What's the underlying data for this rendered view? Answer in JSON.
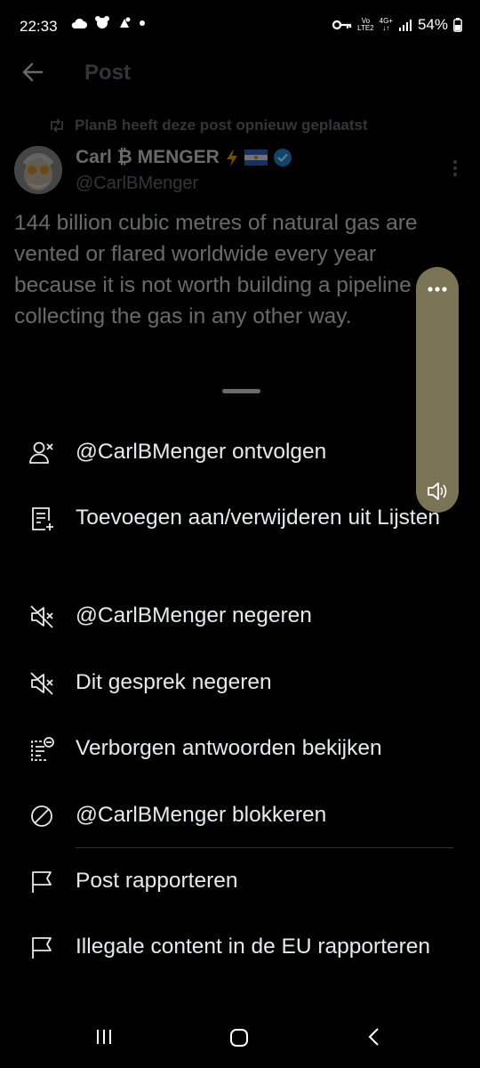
{
  "status_bar": {
    "time": "22:33",
    "network_top": "Vo",
    "network_bottom": "LTE2",
    "network_gen": "4G+",
    "battery": "54%"
  },
  "header": {
    "title": "Post"
  },
  "tweet": {
    "repost_note": "PlanB heeft deze post opnieuw geplaatst",
    "author_name": "Carl ₿ MENGER",
    "author_handle": "@CarlBMenger",
    "text": "144 billion cubic metres of natural gas are vented or flared worldwide every year because it is not worth building a pipeline or collecting the gas in any other way."
  },
  "menu": {
    "items": [
      {
        "label": "@CarlBMenger ontvolgen",
        "icon": "unfollow-icon"
      },
      {
        "label": "Toevoegen aan/verwijderen uit Lijsten",
        "icon": "list-add-icon"
      },
      {
        "label": "@CarlBMenger negeren",
        "icon": "mute-icon"
      },
      {
        "label": "Dit gesprek negeren",
        "icon": "mute-icon"
      },
      {
        "label": "Verborgen antwoorden bekijken",
        "icon": "hidden-replies-icon"
      },
      {
        "label": "@CarlBMenger blokkeren",
        "icon": "block-icon"
      },
      {
        "label": "Post rapporteren",
        "icon": "flag-icon"
      },
      {
        "label": "Illegale content in de EU rapporteren",
        "icon": "flag-icon"
      }
    ]
  },
  "colors": {
    "background": "#000000",
    "text": "#e7e9ea",
    "muted": "#71767b",
    "verified": "#1d9bf0",
    "volume_panel": "#7b7355"
  }
}
